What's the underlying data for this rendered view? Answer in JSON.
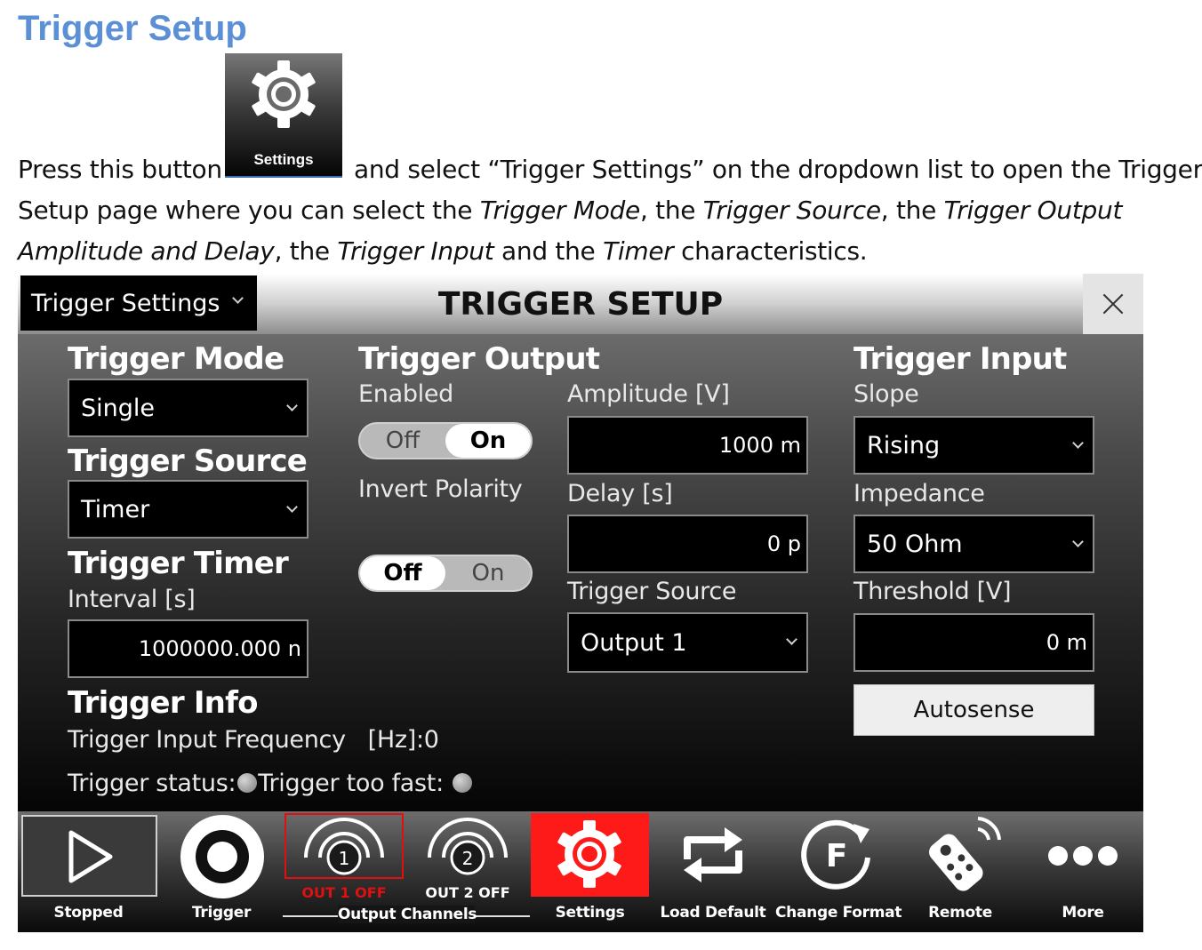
{
  "doc": {
    "heading": "Trigger Setup",
    "inline_button_label": "Settings",
    "line1_before": "Press this button",
    "line1_after": "and select “Trigger Settings” on the dropdown list to open the Trigger",
    "line2_a": "Setup page where you can select the ",
    "line2_b": "Trigger Mode",
    "line2_c": ", the ",
    "line2_d": "Trigger Source",
    "line2_e": ", the ",
    "line2_f": "Trigger Output",
    "line3_a": "Amplitude and Delay",
    "line3_b": ", the ",
    "line3_c": "Trigger Input",
    "line3_d": " and the ",
    "line3_e": "Timer",
    "line3_f": " characteristics."
  },
  "window": {
    "page_select": "Trigger Settings",
    "title": "TRIGGER SETUP"
  },
  "trigger_mode": {
    "header": "Trigger Mode",
    "value": "Single"
  },
  "trigger_source": {
    "header": "Trigger Source",
    "value": "Timer"
  },
  "trigger_timer": {
    "header": "Trigger Timer",
    "interval_label": "Interval [s]",
    "interval_value": "1000000.000",
    "interval_unit": "n"
  },
  "trigger_info": {
    "header": "Trigger Info",
    "freq_label": "Trigger Input Frequency",
    "freq_unit": "[Hz]:",
    "freq_value": "0",
    "status_label": "Trigger status:",
    "too_fast_label": "Trigger too fast:"
  },
  "trigger_output": {
    "header": "Trigger Output",
    "enabled_label": "Enabled",
    "enabled_off": "Off",
    "enabled_on": "On",
    "enabled_state": "On",
    "invert_label": "Invert Polarity",
    "invert_off": "Off",
    "invert_on": "On",
    "invert_state": "Off",
    "amplitude_label": "Amplitude [V]",
    "amplitude_value": "1000",
    "amplitude_unit": "m",
    "delay_label": "Delay [s]",
    "delay_value": "0",
    "delay_unit": "p",
    "source_label": "Trigger Source",
    "source_value": "Output 1"
  },
  "trigger_input": {
    "header": "Trigger Input",
    "slope_label": "Slope",
    "slope_value": "Rising",
    "impedance_label": "Impedance",
    "impedance_value": "50 Ohm",
    "threshold_label": "Threshold [V]",
    "threshold_value": "0",
    "threshold_unit": "m",
    "autosense_label": "Autosense"
  },
  "toolbar": {
    "stopped": "Stopped",
    "trigger": "Trigger",
    "out1_num": "1",
    "out1_status": "OUT 1 OFF",
    "out2_num": "2",
    "out2_status": "OUT 2 OFF",
    "output_channels": "Output Channels",
    "settings": "Settings",
    "load_default": "Load Default",
    "change_format": "Change Format",
    "change_format_letter": "F",
    "remote": "Remote",
    "more": "More"
  },
  "colors": {
    "heading_blue": "#5b8fd6",
    "settings_active": "#ff1a1a",
    "out1_red": "#e01010"
  }
}
